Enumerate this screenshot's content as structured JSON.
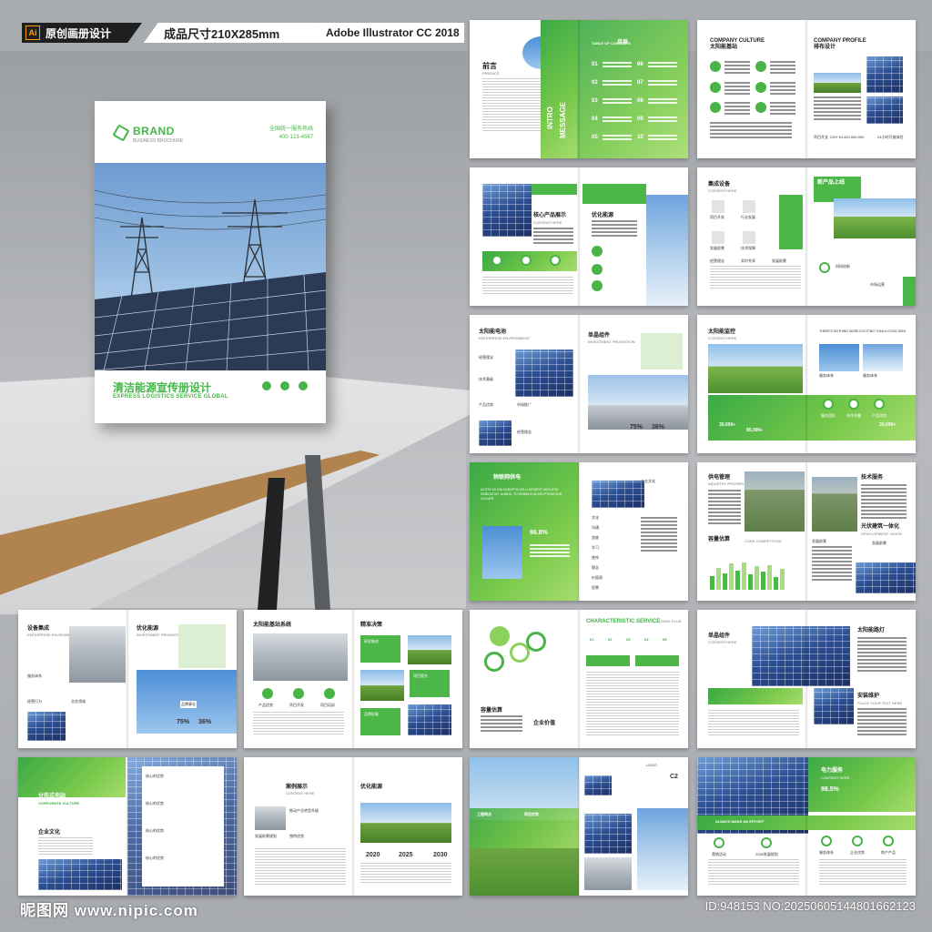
{
  "header": {
    "badge_ai": "原创画册设计",
    "ai_logo": "Ai",
    "size": "成品尺寸210X285mm",
    "software": "Adobe Illustrator CC 2018"
  },
  "cover": {
    "brand": "BRAND",
    "brand_sub": "BUSINESS BROCHURE",
    "hotline": "全国统一服务热线",
    "phone": "400-123-4567",
    "title": "清洁能源宣传册设计",
    "subtitle": "EXPRESS LOGISTICS SERVICE GLOBAL"
  },
  "spreads": {
    "s1": {
      "preface": "前言",
      "preface_en": "PREFACE",
      "intro": "INTRO",
      "message": "MESSAGE",
      "toc": "TABLE OF CONTENTS",
      "toc_cn": "目录",
      "toc_nums": [
        "01",
        "02",
        "03",
        "04",
        "05",
        "06",
        "07",
        "08",
        "09",
        "10"
      ]
    },
    "s2": {
      "culture": "COMPANY CULTURE",
      "culture_cn": "太阳能基站",
      "profile": "COMPANY PROFILE",
      "profile_cn": "排布设计",
      "stat1": "项目开支",
      "stat2": "CNY ¥4,320,000,000",
      "stat3": "24小时开放体验"
    },
    "s3": {
      "title": "核心产品展示",
      "content": "CONTENT HERE",
      "right_title": "优化能源"
    },
    "s4": {
      "title": "集成设备",
      "content": "CONTENT HERE",
      "items": [
        "项目开发",
        "行业发展",
        "发展前景",
        "技术保障"
      ],
      "right": [
        "新产品上线",
        "科研创新"
      ],
      "left_more": [
        "经营理念",
        "实时共享",
        "发展前景"
      ],
      "right_more": [
        "市场运营"
      ]
    },
    "s5": {
      "title": "太阳能电池",
      "sub": "ENTERPRISE ENVIRONMENT",
      "right_title": "单晶组件",
      "right_sub": "INVESTMENT PROMOTION",
      "items": [
        "经营理念",
        "技术基础",
        "产品优势",
        "市场推广",
        "经营理念"
      ],
      "pct1": "75%",
      "pct2": "36%"
    },
    "s6": {
      "title": "太阳能监控",
      "content": "CONTENT HERE",
      "right_head": "THERE'S NOTHING MORE EXCITING THAN A GOOD IDEA",
      "icons": [
        "服务团队",
        "合作共赢",
        "产品优势"
      ],
      "n1": "30,000+",
      "n2": "85,000+",
      "n3": "30,000+",
      "labels": [
        "服务体系",
        "服务体系"
      ]
    },
    "s7": {
      "title": "物联网供电",
      "latin": "AXITAT AS DIN KADOPTA VOLU DESERIT NECULPA DEBICATUR, ALIBUS, TO DEBIM EUM ARUPTIUM OUR VOLUER",
      "pct": "96.8%",
      "culture": "企业文化",
      "words": [
        "文化",
        "沟通",
        "态度",
        "学习",
        "使命",
        "理念",
        "价值观",
        "愿景"
      ]
    },
    "s8": {
      "title": "供电管理",
      "sub": "INDUSTRY PROSPECTS",
      "tech": "技术服务",
      "mid": "容量估算",
      "core": "CORE COMPETITION",
      "right": "光伏建筑一体化",
      "right_sub": "DEVELOPMENT VISION",
      "more": "发展前景",
      "more2": "发展前景"
    },
    "s9": {
      "title": "设备集成",
      "sub": "ENTERPRISE ENVIRONMENT",
      "right_title": "优化能源",
      "right_sub": "INVESTMENT PROMOTION",
      "items": [
        "服务体系",
        "经营行为",
        "业务领域"
      ],
      "center": "品牌事业",
      "pct1": "75%",
      "pct2": "36%"
    },
    "s10": {
      "title": "太阳能基站系统",
      "right": "精准决策",
      "icons": [
        "产品优势",
        "项目开发",
        "项目培训"
      ],
      "tags": [
        "研发推进",
        "项目提名",
        "品牌形象"
      ]
    },
    "s11": {
      "title": "CHARACTERISTIC SERVICE",
      "page": "PAGE PLUS",
      "cap": "容量估算",
      "cap2": "企业价值",
      "nums": [
        "01",
        "02",
        "03",
        "04",
        "05"
      ]
    },
    "s12": {
      "title": "单晶组件",
      "content": "CONTENT HERE",
      "right": "太阳能路灯",
      "right2": "安装维护",
      "right2_sub": "PLACE YOUR TEXT HERE"
    },
    "s13": {
      "title": "分布式电站",
      "sub": "CORPORATE CULTURE",
      "c1": "企业文化",
      "list": [
        "核心的优势",
        "核心的优势",
        "核心的优势",
        "核心的优势"
      ]
    },
    "s14": {
      "title": "案例展示",
      "content": "CONTENT HERE",
      "item": "推动产业转型升级",
      "item2": "发展前景规划",
      "item3": "独特优势",
      "right": "优化能源",
      "years": [
        "2020",
        "2025",
        "2030"
      ]
    },
    "s15": {
      "logo": "LOGO",
      "c2": "C2",
      "items": [
        "工程特点",
        "项目优势"
      ]
    },
    "s16": {
      "title": "电力服务",
      "content": "CONTENT HERE",
      "pct": "98.5%",
      "effort": "ALWAYS MAKE AN EFFORT",
      "labels": [
        "营销活动",
        "2030发展规划"
      ],
      "icons": [
        "服务体系",
        "企业优势",
        "地产产品"
      ]
    }
  },
  "footer": {
    "site": "昵图网 www.nipic.com",
    "id": "ID:948153 NO:20250605144801662123"
  }
}
